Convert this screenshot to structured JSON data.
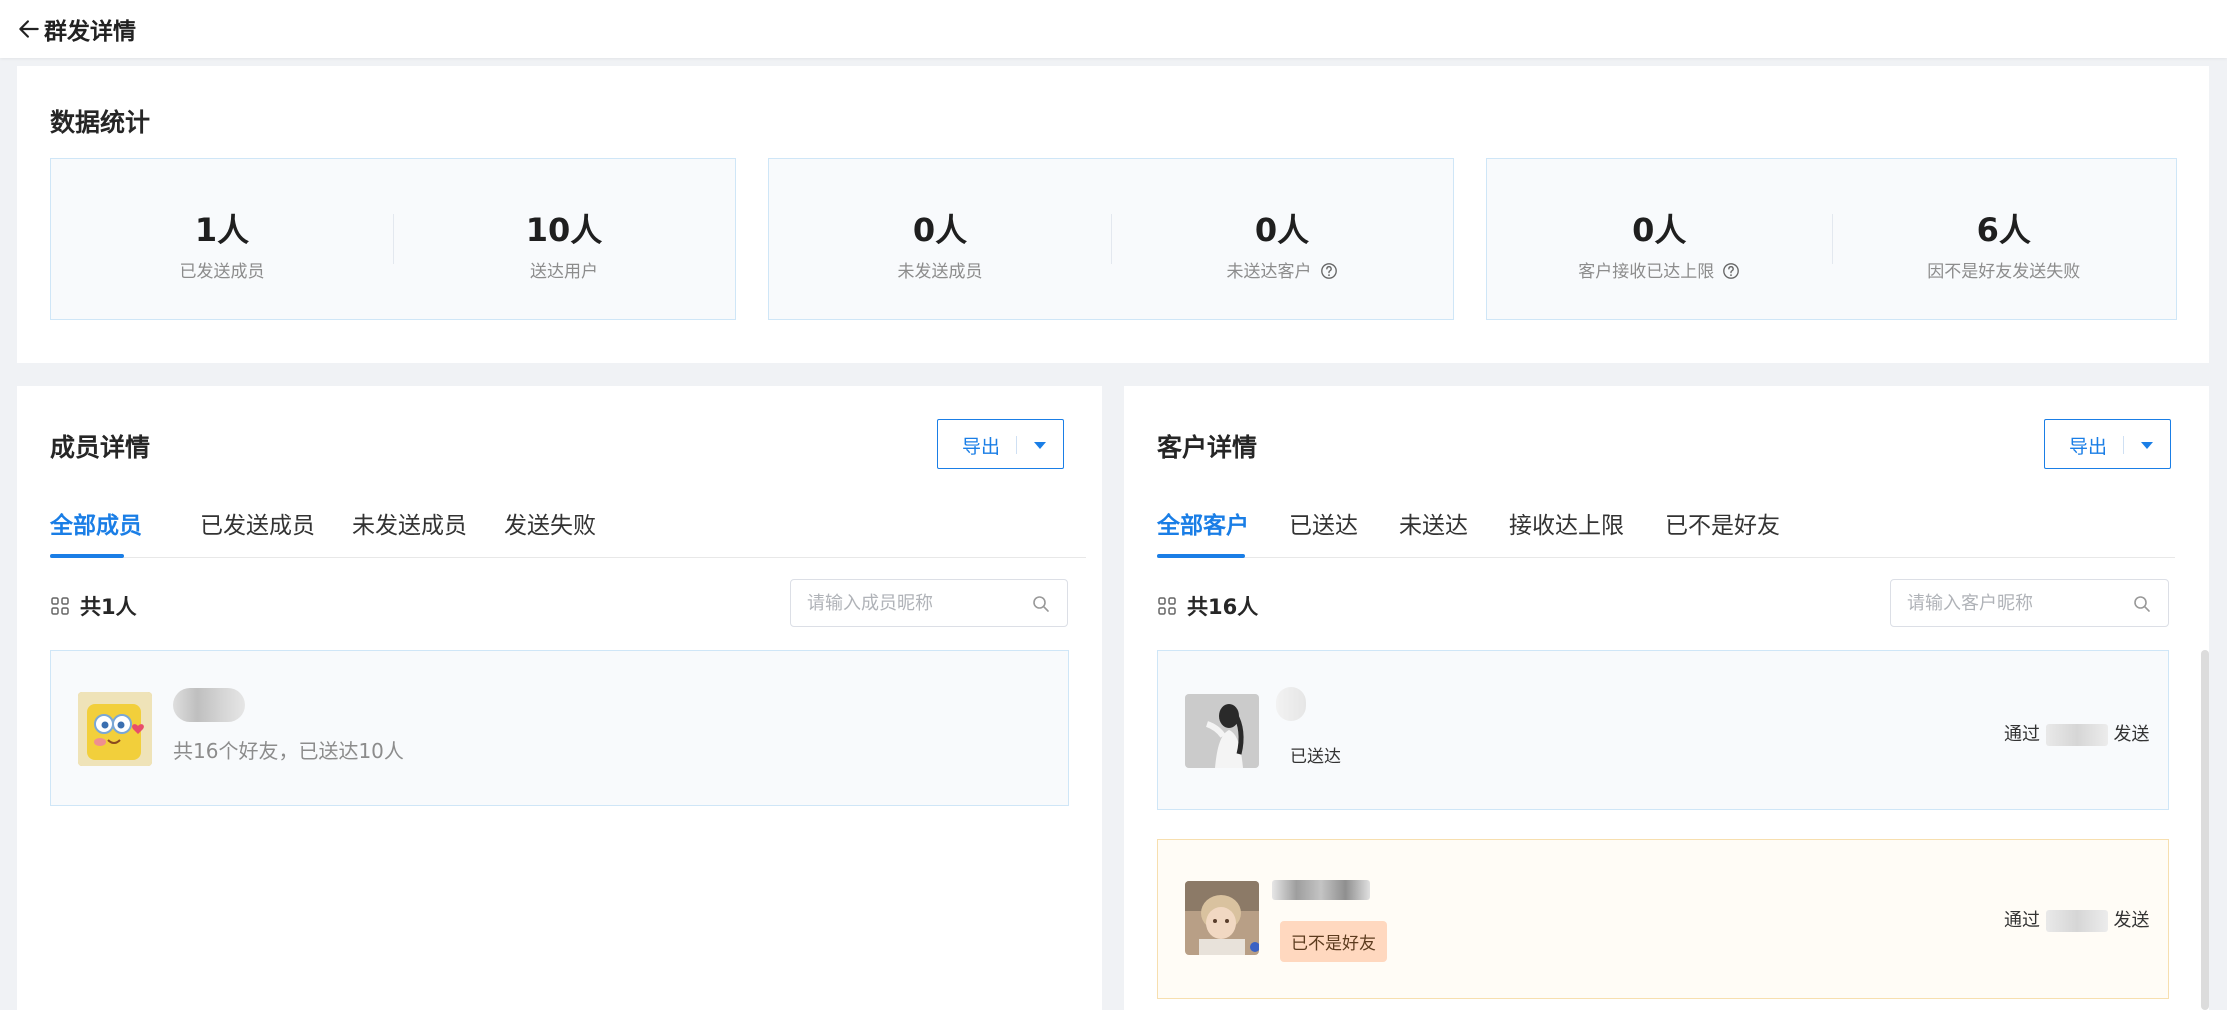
{
  "header": {
    "title": "群发详情"
  },
  "stats": {
    "title": "数据统计",
    "groups": [
      {
        "items": [
          {
            "value": "1人",
            "label": "已发送成员"
          },
          {
            "value": "10人",
            "label": "送达用户"
          }
        ]
      },
      {
        "items": [
          {
            "value": "0人",
            "label": "未发送成员"
          },
          {
            "value": "0人",
            "label": "未送达客户"
          }
        ]
      },
      {
        "items": [
          {
            "value": "0人",
            "label": "客户接收已达上限"
          },
          {
            "value": "6人",
            "label": "因不是好友发送失败"
          }
        ]
      }
    ]
  },
  "members": {
    "title": "成员详情",
    "export_label": "导出",
    "tabs": [
      "全部成员",
      "已发送成员",
      "未发送成员",
      "发送失败"
    ],
    "count": "共1人",
    "search_placeholder": "请输入成员昵称",
    "items": [
      {
        "summary": "共16个好友，已送达10人"
      }
    ]
  },
  "customers": {
    "title": "客户详情",
    "export_label": "导出",
    "tabs": [
      "全部客户",
      "已送达",
      "未送达",
      "接收达上限",
      "已不是好友"
    ],
    "count": "共16人",
    "search_placeholder": "请输入客户昵称",
    "items": [
      {
        "status": "已送达",
        "via_prefix": "通过",
        "via_suffix": "发送"
      },
      {
        "status": "已不是好友",
        "via_prefix": "通过",
        "via_suffix": "发送"
      }
    ]
  },
  "colors": {
    "accent": "#1a7ee6",
    "warn_tag": "#ffd8bf",
    "warn_border": "#f7dfaf"
  },
  "icons": [
    "arrow-left-icon",
    "help-circle-icon",
    "caret-down-icon",
    "grid-icon",
    "search-icon"
  ]
}
